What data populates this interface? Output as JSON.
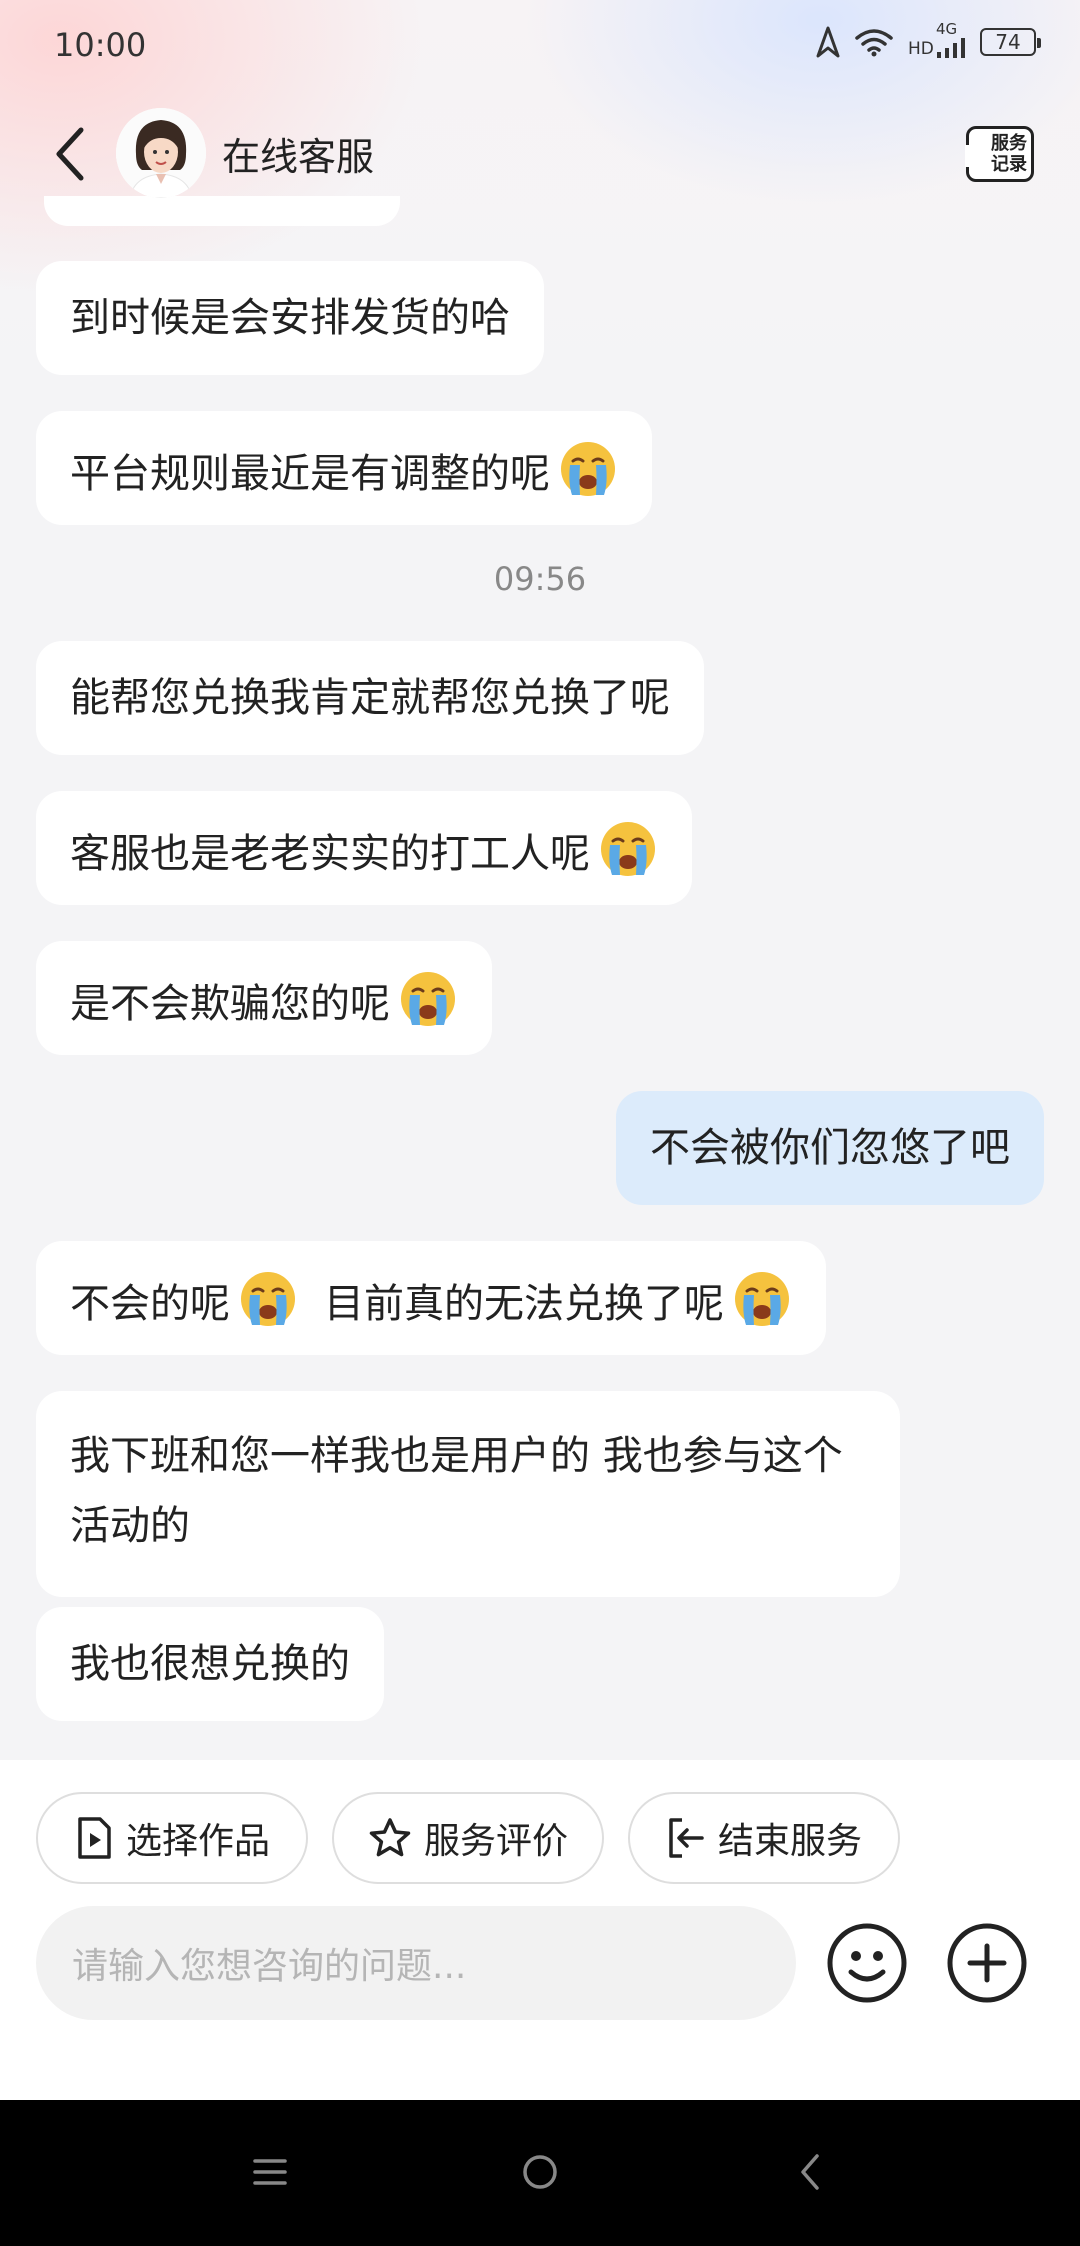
{
  "status_bar": {
    "time": "10:00",
    "network_label": "HD",
    "network_type": "4G",
    "battery": "74"
  },
  "header": {
    "title": "在线客服",
    "record_line1": "服务",
    "record_line2": "记录"
  },
  "messages": [
    {
      "side": "in",
      "text": "到时候是会安排发货的哈"
    },
    {
      "side": "in",
      "text": "平台规则最近是有调整的呢",
      "emoji": "crying-face"
    },
    {
      "side": "in",
      "text": "能帮您兑换我肯定就帮您兑换了呢"
    },
    {
      "side": "in",
      "text": "客服也是老老实实的打工人呢",
      "emoji": "crying-face"
    },
    {
      "side": "in",
      "text": "是不会欺骗您的呢",
      "emoji": "crying-face"
    },
    {
      "side": "out",
      "text": "不会被你们忽悠了吧"
    },
    {
      "side": "in",
      "text_a": "不会的呢",
      "text_b": "目前真的无法兑换了呢",
      "emoji": "crying-face"
    },
    {
      "side": "in",
      "text": "我下班和您一样我也是用户的 我也参与这个活动的"
    },
    {
      "side": "in",
      "text": "我也很想兑换的"
    }
  ],
  "timestamp": "09:56",
  "quick_actions": [
    {
      "label": "选择作品",
      "icon": "video-file-icon"
    },
    {
      "label": "服务评价",
      "icon": "star-icon"
    },
    {
      "label": "结束服务",
      "icon": "exit-icon"
    }
  ],
  "input": {
    "placeholder": "请输入您想咨询的问题..."
  },
  "colors": {
    "outgoing_bubble": "#dcebfb",
    "incoming_bubble": "#ffffff",
    "background": "#f4f4f6"
  }
}
